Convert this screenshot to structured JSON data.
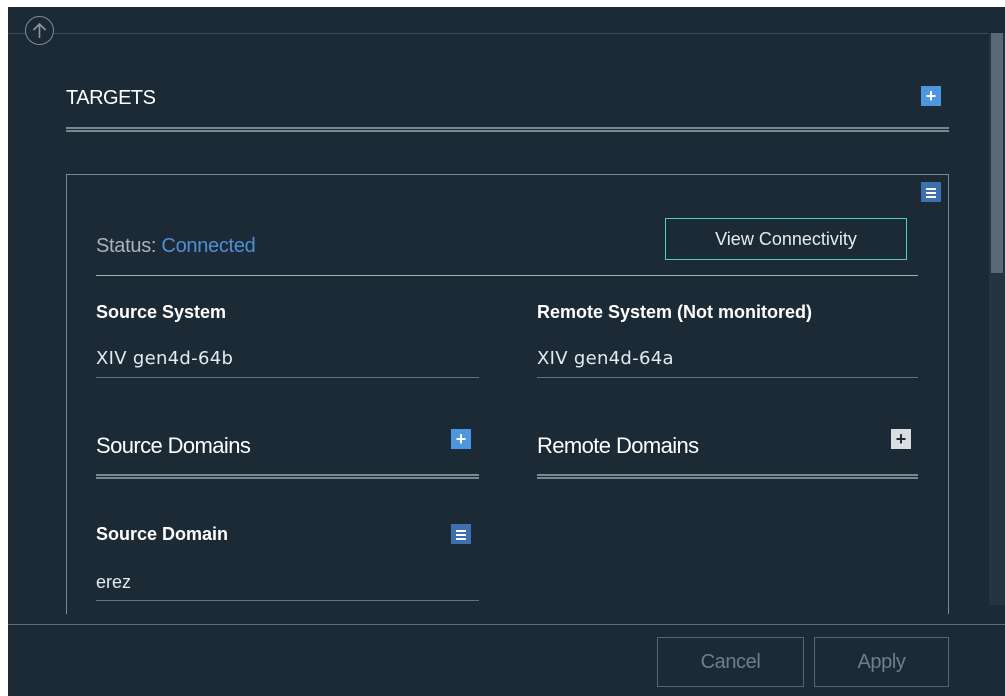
{
  "header": {
    "up_icon": "arrow-up-circle-icon"
  },
  "section": {
    "title": "TARGETS",
    "add_icon": "plus-icon"
  },
  "target": {
    "menu_icon": "hamburger-menu-icon",
    "status_label": "Status:",
    "status_value": "Connected",
    "status_color": "#4e8fd6",
    "view_connectivity_label": "View Connectivity",
    "source_system_label": "Source System",
    "source_system_value": "XIV gen4d-64b",
    "remote_system_label": "Remote System (Not monitored)",
    "remote_system_value": "XIV gen4d-64a",
    "source_domains_label": "Source Domains",
    "remote_domains_label": "Remote Domains",
    "source_domain_label": "Source Domain",
    "source_domain_value": "erez"
  },
  "footer": {
    "cancel_label": "Cancel",
    "apply_label": "Apply"
  },
  "colors": {
    "panel_bg": "#1c2a35",
    "accent_blue": "#4e97e0",
    "accent_teal": "#4ed0b9"
  }
}
